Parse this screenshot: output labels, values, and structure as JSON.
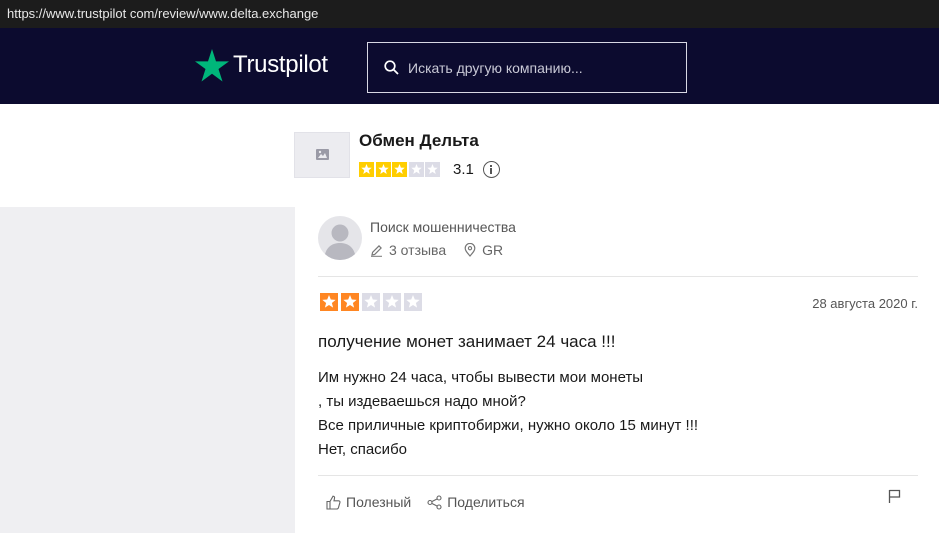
{
  "browser": {
    "url": "https://www.trustpilot com/review/www.delta.exchange"
  },
  "header": {
    "logo_text": "Trustpilot",
    "search": {
      "placeholder": "Искать другую компанию..."
    }
  },
  "company": {
    "name": "Обмен Дельта",
    "rating_stars": 3,
    "score": "3.1",
    "colors": {
      "star_filled": "#ffce00",
      "star_empty": "#dcdce6"
    }
  },
  "review": {
    "reviewer_name": "Поиск мошенничества",
    "reviews_count": "3 отзыва",
    "country": "GR",
    "rating_stars": 2,
    "date": "28 августа 2020 г.",
    "title": "получение монет занимает 24 часа !!!",
    "body_lines": [
      "Им нужно 24 часа, чтобы вывести мои монеты",
      ", ты издеваешься надо мной?",
      "Все приличные криптобиржи, нужно около 15 минут !!!",
      "Нет, спасибо"
    ],
    "colors": {
      "star_filled": "#ff8622",
      "star_empty": "#dcdce6"
    },
    "actions": {
      "useful_label": "Полезный",
      "share_label": "Поделиться"
    }
  },
  "icons": [
    "star-logo-icon",
    "search-icon",
    "image-placeholder-icon",
    "info-icon",
    "pencil-icon",
    "location-pin-icon",
    "thumbs-up-icon",
    "share-icon",
    "flag-icon"
  ]
}
